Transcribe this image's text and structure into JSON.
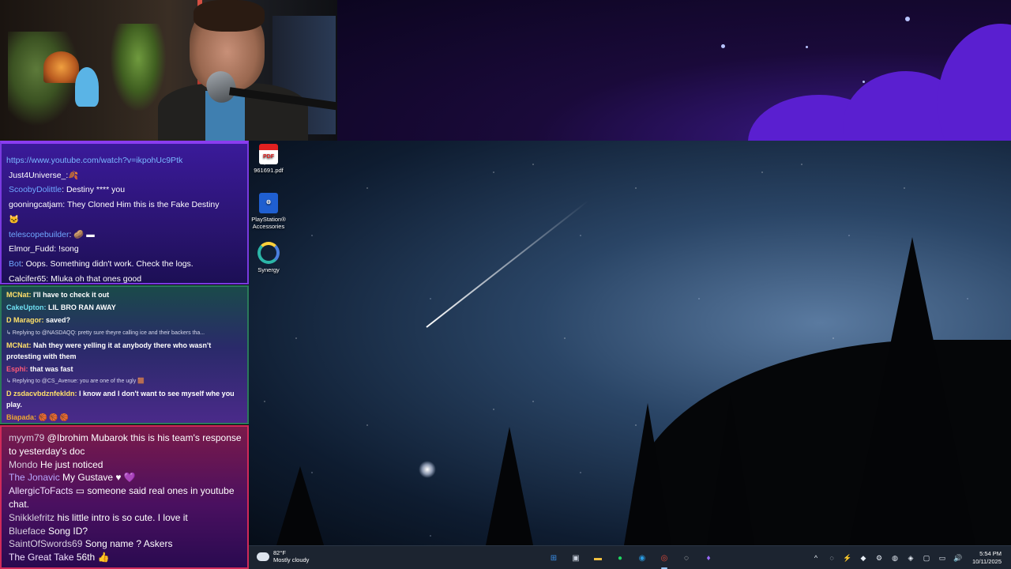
{
  "chat1": {
    "link": "https://www.youtube.com/watch?v=ikpohUc9Ptk",
    "messages": [
      {
        "user": "Just4Universe_:",
        "text": "🍂",
        "color": "#ffffff"
      },
      {
        "user": "ScoobyDolittle",
        "text": ": Destiny **** you",
        "color": "#6fa8ff"
      },
      {
        "user": "gooningcatjam",
        "text": ": They Cloned Him this is the Fake Destiny",
        "color": "#ffffff"
      },
      {
        "user": "",
        "text": "🐱",
        "color": "#ffffff"
      },
      {
        "user": "telescopebuilder",
        "text": ": 🥔 ▬",
        "color": "#6fa8ff"
      },
      {
        "user": "Elmor_Fudd",
        "text": ": !song",
        "color": "#ffffff"
      },
      {
        "user": "Bot",
        "text": ": Oops. Something didn't work. Check the logs.",
        "color": "#6fa8ff"
      },
      {
        "user": "Calcifer65",
        "text": ": Mluka oh that ones good",
        "color": "#ffffff"
      }
    ]
  },
  "chat2": {
    "messages": [
      {
        "type": "msg",
        "user": "MCNat:",
        "text": " I'll have to check it out",
        "color": "#ffe06a"
      },
      {
        "type": "msg",
        "user": "CakeUpton:",
        "text": " LIL BRO RAN AWAY",
        "color": "#6ee0f0"
      },
      {
        "type": "msg",
        "user": "D Maragor:",
        "text": " saved?",
        "color": "#ffe06a"
      },
      {
        "type": "reply",
        "text": "↳ Replying to @NASDAQQ: pretty sure theyre calling ice and their backers tha..."
      },
      {
        "type": "wrap",
        "user": "MCNat:",
        "text": " Nah they were yelling it at anybody there who wasn't protesting with them",
        "color": "#ffe06a"
      },
      {
        "type": "msg",
        "user": "Esphi:",
        "text": " that was fast",
        "color": "#ff5a78"
      },
      {
        "type": "reply",
        "text": "↳ Replying to @CS_Avenue: you are one of the ugly 🟫"
      },
      {
        "type": "wrap",
        "user": "D zsdacvbdznfekldn:",
        "text": " I know and I don't want to see myself whe you play.",
        "color": "#ffe06a"
      },
      {
        "type": "msg",
        "user": "Biapada:",
        "text": " 🏀 🏀 🏀",
        "color": "#f0a830"
      }
    ]
  },
  "chat3": {
    "messages": [
      {
        "user": "myym79",
        "text": " @Ibrohim Mubarok this is his team's response to yesterday's doc",
        "color": "#d8d0e0"
      },
      {
        "user": "Mondo",
        "text": " He just noticed",
        "color": "#d8d0e0"
      },
      {
        "user": "The Jonavic",
        "text": " My Gustave ♥ 💜",
        "color": "#b8a8ff"
      },
      {
        "user": "AllergicToFacts",
        "text": " ▭ someone said real ones in youtube chat.",
        "color": "#f0e0ff"
      },
      {
        "user": "Snikklefritz",
        "text": " his little intro is so cute. I love it",
        "color": "#d8d0e0"
      },
      {
        "user": "Blueface",
        "text": " Song ID?",
        "color": "#d8d0e0"
      },
      {
        "user": "SaintOfSwords69",
        "text": " Song name ? Askers",
        "color": "#d8d0e0"
      },
      {
        "user": "The Great Take",
        "text": " 56th 👍",
        "color": "#f0e0ff"
      }
    ]
  },
  "desktop": {
    "icons": [
      {
        "label": "961691.pdf",
        "icon": "pdf-file-icon",
        "glyph": "PDF"
      },
      {
        "label": "PlayStation® Accessories",
        "icon": "playstation-icon",
        "glyph": "⚙"
      },
      {
        "label": "Synergy",
        "icon": "synergy-icon",
        "glyph": ""
      }
    ]
  },
  "taskbar": {
    "weather_temp": "82°F",
    "weather_desc": "Mostly cloudy",
    "apps": [
      {
        "name": "start-button",
        "glyph": "⊞",
        "color": "#3a8ee6"
      },
      {
        "name": "task-view-button",
        "glyph": "▣",
        "color": "#c8d0dc"
      },
      {
        "name": "file-explorer-icon",
        "glyph": "▬",
        "color": "#f0c040"
      },
      {
        "name": "spotify-icon",
        "glyph": "●",
        "color": "#1ed760"
      },
      {
        "name": "edge-icon",
        "glyph": "◉",
        "color": "#2a9ae0"
      },
      {
        "name": "chrome-icon",
        "glyph": "◎",
        "color": "#e04a3a"
      },
      {
        "name": "obs-icon",
        "glyph": "◌",
        "color": "#e8e8e8"
      },
      {
        "name": "app-icon",
        "glyph": "♦",
        "color": "#9a6aff"
      }
    ],
    "tray": [
      {
        "name": "chevron-icon",
        "glyph": "^"
      },
      {
        "name": "sync-icon",
        "glyph": "◌"
      },
      {
        "name": "app-tray-icon",
        "glyph": "⚡"
      },
      {
        "name": "onenote-icon",
        "glyph": "◆"
      },
      {
        "name": "steam-icon",
        "glyph": "⚙"
      },
      {
        "name": "network-icon",
        "glyph": "◍"
      },
      {
        "name": "gpu-icon",
        "glyph": "◈"
      },
      {
        "name": "security-icon",
        "glyph": "▢"
      },
      {
        "name": "monitor-icon",
        "glyph": "▭"
      },
      {
        "name": "volume-icon",
        "glyph": "🔊"
      }
    ],
    "time": "5:54 PM",
    "date": "10/11/2025"
  }
}
